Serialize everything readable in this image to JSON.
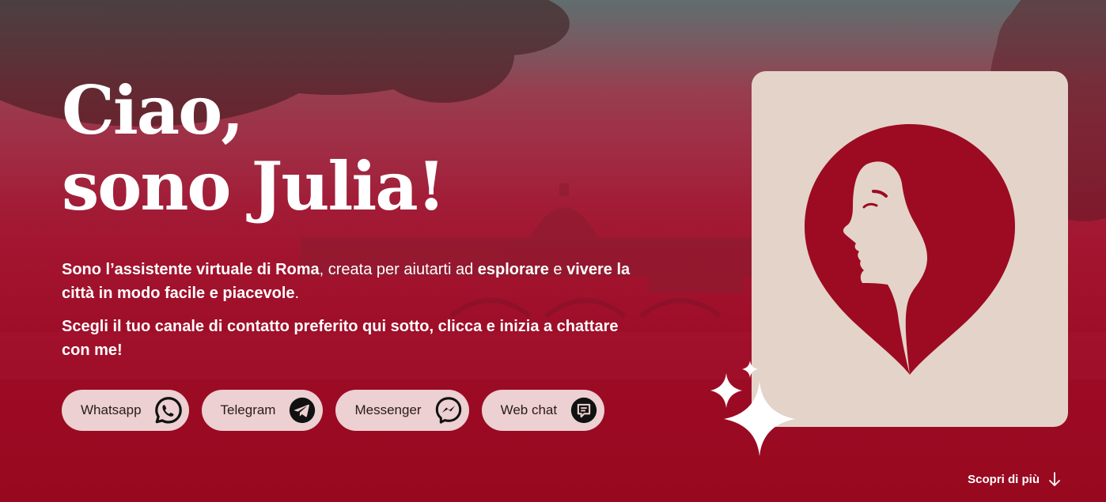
{
  "hero": {
    "title_line1": "Ciao,",
    "title_line2": "sono Julia!",
    "intro": {
      "part1": "Sono l’assistente virtuale di Roma",
      "part2": ", creata per aiutarti ad ",
      "part3": "esplorare",
      "part4": " e ",
      "part5": "vivere la città in modo facile e piacevole",
      "part6": "."
    },
    "intro2": "Scegli il tuo canale di contatto preferito qui sotto, clicca e inizia a chattare con me!"
  },
  "channels": [
    {
      "label": "Whatsapp",
      "icon": "whatsapp-icon"
    },
    {
      "label": "Telegram",
      "icon": "telegram-icon"
    },
    {
      "label": "Messenger",
      "icon": "messenger-icon"
    },
    {
      "label": "Web chat",
      "icon": "web-chat-icon"
    }
  ],
  "discover": {
    "label": "Scopri di più",
    "icon": "arrow-down-icon"
  },
  "colors": {
    "brand": "#9a0b22",
    "card": "#e4d3c9",
    "button": "#ecd0d2"
  }
}
